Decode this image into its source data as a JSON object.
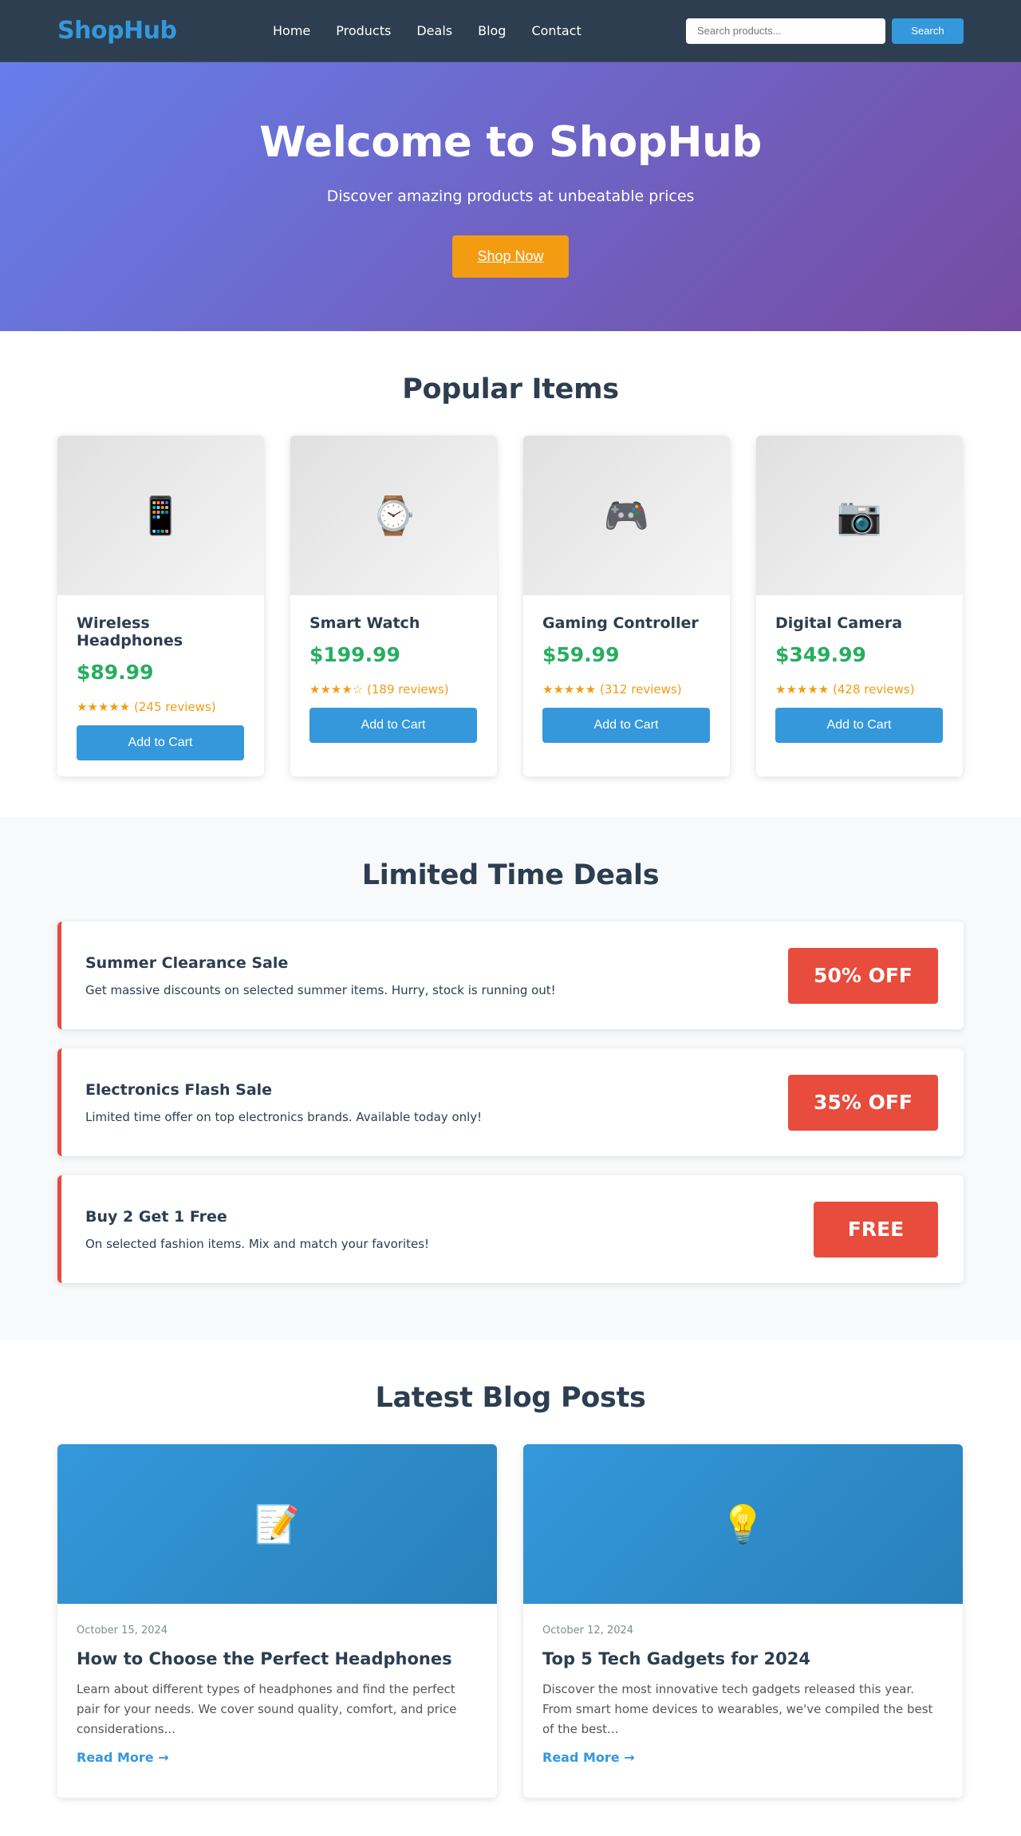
{
  "nav": {
    "logo": "ShopHub",
    "links": [
      "Home",
      "Products",
      "Deals",
      "Blog",
      "Contact"
    ],
    "search_placeholder": "Search products...",
    "search_button": "Search"
  },
  "hero": {
    "title": "Welcome to ShopHub",
    "subtitle": "Discover amazing products at unbeatable prices",
    "cta": "Shop Now"
  },
  "popular": {
    "title": "Popular Items",
    "products": [
      {
        "icon": "📱",
        "icon_name": "mobile-phone-icon",
        "name": "Wireless Headphones",
        "price": "$89.99",
        "stars": "★★★★★",
        "reviews": "(245 reviews)",
        "button": "Add to Cart"
      },
      {
        "icon": "⌚",
        "icon_name": "watch-icon",
        "name": "Smart Watch",
        "price": "$199.99",
        "stars": "★★★★☆",
        "reviews": "(189 reviews)",
        "button": "Add to Cart"
      },
      {
        "icon": "🎮",
        "icon_name": "game-controller-icon",
        "name": "Gaming Controller",
        "price": "$59.99",
        "stars": "★★★★★",
        "reviews": "(312 reviews)",
        "button": "Add to Cart"
      },
      {
        "icon": "📷",
        "icon_name": "camera-icon",
        "name": "Digital Camera",
        "price": "$349.99",
        "stars": "★★★★★",
        "reviews": "(428 reviews)",
        "button": "Add to Cart"
      }
    ]
  },
  "deals": {
    "title": "Limited Time Deals",
    "items": [
      {
        "title": "Summer Clearance Sale",
        "description": "Get massive discounts on selected summer items. Hurry, stock is running out!",
        "badge": "50% OFF"
      },
      {
        "title": "Electronics Flash Sale",
        "description": "Limited time offer on top electronics brands. Available today only!",
        "badge": "35% OFF"
      },
      {
        "title": "Buy 2 Get 1 Free",
        "description": "On selected fashion items. Mix and match your favorites!",
        "badge": "FREE"
      }
    ]
  },
  "blog": {
    "title": "Latest Blog Posts",
    "posts": [
      {
        "icon": "📝",
        "icon_name": "memo-icon",
        "date": "October 15, 2024",
        "title": "How to Choose the Perfect Headphones",
        "excerpt": "Learn about different types of headphones and find the perfect pair for your needs. We cover sound quality, comfort, and price considerations...",
        "link": "Read More →"
      },
      {
        "icon": "💡",
        "icon_name": "light-bulb-icon",
        "date": "October 12, 2024",
        "title": "Top 5 Tech Gadgets for 2024",
        "excerpt": "Discover the most innovative tech gadgets released this year. From smart home devices to wearables, we've compiled the best of the best...",
        "link": "Read More →"
      }
    ]
  },
  "colors": {
    "nav_bg": "#2c3e50",
    "brand": "#3498db",
    "accent": "#f39c12",
    "price": "#27ae60",
    "deal": "#e74c3c"
  }
}
